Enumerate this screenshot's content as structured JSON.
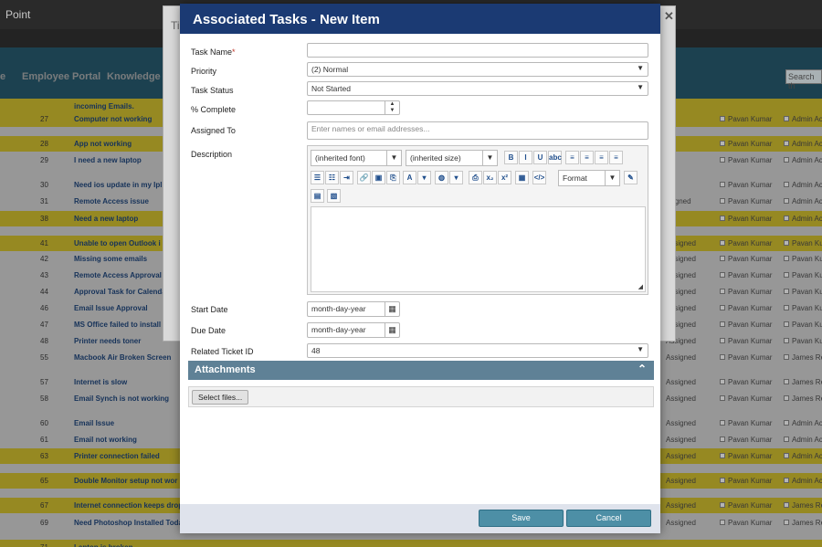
{
  "background": {
    "brand": "Point",
    "nav": [
      "e",
      "Employee Portal",
      "Knowledge Ba"
    ],
    "search_placeholder": "Search th",
    "dialog_title": "Ti",
    "rows": [
      {
        "id": "",
        "title": "incoming Emails.",
        "status": "",
        "assigned": "",
        "by": "",
        "hl": true
      },
      {
        "id": "27",
        "title": "Computer not working",
        "status": "",
        "assigned": "Pavan Kumar",
        "by": "Admin Ac",
        "hl": true
      },
      {
        "id": "28",
        "title": "App not working",
        "status": "",
        "assigned": "Pavan Kumar",
        "by": "Admin Ac",
        "hl": true
      },
      {
        "id": "29",
        "title": "I need a new laptop",
        "status": "",
        "assigned": "Pavan Kumar",
        "by": "Admin Ac",
        "hl": false
      },
      {
        "id": "30",
        "title": "Need ios update in my Ipl",
        "status": "",
        "assigned": "Pavan Kumar",
        "by": "Admin Ac",
        "hl": false
      },
      {
        "id": "31",
        "title": "Remote Access issue",
        "status": "ssigned",
        "assigned": "Pavan Kumar",
        "by": "Admin Ac",
        "hl": false
      },
      {
        "id": "38",
        "title": "Need a new laptop",
        "status": "",
        "assigned": "Pavan Kumar",
        "by": "Admin Ac",
        "hl": true
      },
      {
        "id": "41",
        "title": "Unable to open Outlook i",
        "status": "Assigned",
        "assigned": "Pavan Kumar",
        "by": "Pavan Kur",
        "hl": true
      },
      {
        "id": "42",
        "title": "Missing some emails",
        "status": "Assigned",
        "assigned": "Pavan Kumar",
        "by": "Pavan Kur",
        "hl": false
      },
      {
        "id": "43",
        "title": "Remote Access Approval T",
        "status": "Assigned",
        "assigned": "Pavan Kumar",
        "by": "Pavan Kur",
        "hl": false
      },
      {
        "id": "44",
        "title": "Approval Task for Calenda",
        "status": "Assigned",
        "assigned": "Pavan Kumar",
        "by": "Pavan Kur",
        "hl": false
      },
      {
        "id": "46",
        "title": "Email Issue Approval",
        "status": "Assigned",
        "assigned": "Pavan Kumar",
        "by": "Pavan Kur",
        "hl": false
      },
      {
        "id": "47",
        "title": "MS Office failed to install",
        "status": "Assigned",
        "assigned": "Pavan Kumar",
        "by": "Pavan Kur",
        "hl": false
      },
      {
        "id": "48",
        "title": "Printer needs toner",
        "status": "Assigned",
        "assigned": "Pavan Kumar",
        "by": "Pavan Kur",
        "hl": false
      },
      {
        "id": "55",
        "title": "Macbook Air Broken Screen",
        "status": "Assigned",
        "assigned": "Pavan Kumar",
        "by": "James Re",
        "hl": false
      },
      {
        "id": "57",
        "title": "Internet is slow",
        "status": "Assigned",
        "assigned": "Pavan Kumar",
        "by": "James Re",
        "hl": false
      },
      {
        "id": "58",
        "title": "Email Synch is not working",
        "status": "Assigned",
        "assigned": "Pavan Kumar",
        "by": "James Re",
        "hl": false
      },
      {
        "id": "60",
        "title": "Email Issue",
        "status": "Assigned",
        "assigned": "Pavan Kumar",
        "by": "Admin Ac",
        "hl": false
      },
      {
        "id": "61",
        "title": "Email not working",
        "status": "Assigned",
        "assigned": "Pavan Kumar",
        "by": "Admin Ac",
        "hl": false
      },
      {
        "id": "63",
        "title": "Printer connection failed",
        "status": "Assigned",
        "assigned": "Pavan Kumar",
        "by": "Admin Ac",
        "hl": true
      },
      {
        "id": "65",
        "title": "Double Monitor setup not wor",
        "status": "Assigned",
        "assigned": "Pavan Kumar",
        "by": "Admin Ac",
        "hl": true
      },
      {
        "id": "67",
        "title": "Internet connection keeps drop",
        "status": "Assigned",
        "assigned": "Pavan Kumar",
        "by": "James Re",
        "hl": true
      },
      {
        "id": "69",
        "title": "Need Photoshop Installed Toda",
        "status": "Assigned",
        "assigned": "Pavan Kumar",
        "by": "James Re",
        "hl": false
      },
      {
        "id": "71",
        "title": "Laptop is broken",
        "status": "",
        "assigned": "",
        "by": "",
        "hl": true
      }
    ]
  },
  "modal": {
    "title": "Associated Tasks - New Item",
    "fields": {
      "task_name": {
        "label": "Task Name",
        "required_mark": "*",
        "value": ""
      },
      "priority": {
        "label": "Priority",
        "value": "(2) Normal"
      },
      "task_status": {
        "label": "Task Status",
        "value": "Not Started"
      },
      "percent_complete": {
        "label": "% Complete",
        "value": ""
      },
      "assigned_to": {
        "label": "Assigned To",
        "placeholder": "Enter names or email addresses..."
      },
      "description": {
        "label": "Description"
      },
      "start_date": {
        "label": "Start Date",
        "value": "month-day-year"
      },
      "due_date": {
        "label": "Due Date",
        "value": "month-day-year"
      },
      "related_ticket": {
        "label": "Related Ticket ID",
        "value": "48"
      }
    },
    "editor": {
      "font": "(inherited font)",
      "size": "(inherited size)",
      "format": "Format",
      "buttons_row1": [
        "B",
        "I",
        "U",
        "abc",
        "≡",
        "≡",
        "≡",
        "≡"
      ],
      "buttons_row2": [
        "☰",
        "☷",
        "⇥",
        "🔗",
        "▣",
        "⎘",
        "A",
        "▾",
        "◍",
        "▾",
        "⎙",
        "x₂",
        "x²",
        "▦",
        "</>"
      ],
      "buttons_row3": [
        "▤",
        "▧"
      ]
    },
    "attachments": {
      "title": "Attachments",
      "select_files": "Select files..."
    },
    "save_label": "Save",
    "cancel_label": "Cancel"
  }
}
